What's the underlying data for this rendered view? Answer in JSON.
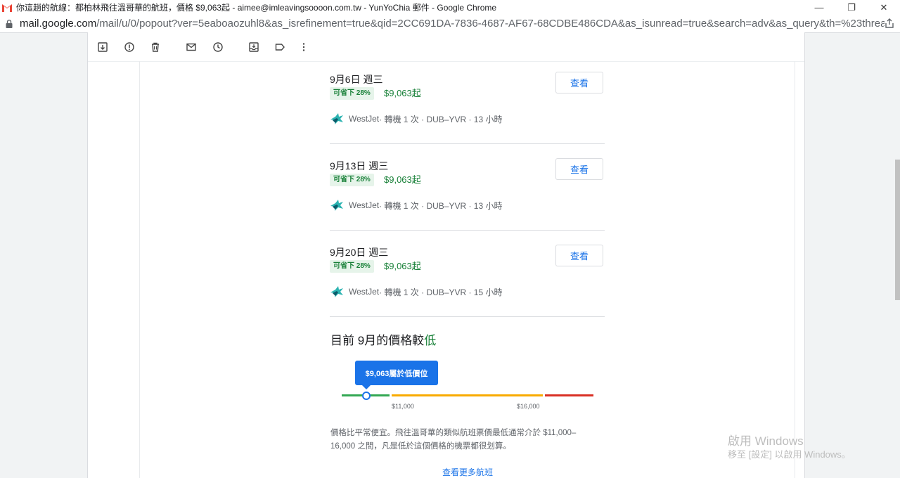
{
  "window": {
    "title": "你這趟的航線：都柏林飛往溫哥華的航班，價格 $9,063起 - aimee@imleavingsoooon.com.tw - YunYoChia 郵件 - Google Chrome",
    "controls": {
      "minimize": "—",
      "restore": "❐",
      "close": "✕"
    }
  },
  "address_bar": {
    "host": "mail.google.com",
    "path": "/mail/u/0/popout?ver=5eaboaozuhl8&as_isrefinement=true&qid=2CC691DA-7836-4687-AF67-68CDBE486CDA&as_isunread=true&search=adv&as_query&th=%23thread-f:176..."
  },
  "toolbar": {
    "icons": [
      "archive-icon",
      "report-spam-icon",
      "delete-icon",
      "mark-unread-icon",
      "snooze-icon",
      "move-to-icon",
      "label-icon",
      "more-icon"
    ]
  },
  "flights": [
    {
      "date": "9月6日 週三",
      "badge": "可省下 28%",
      "price": "$9,063起",
      "view": "查看",
      "airline": "WestJet",
      "details": " · 轉機 1 次 · DUB–YVR · 13 小時"
    },
    {
      "date": "9月13日 週三",
      "badge": "可省下 28%",
      "price": "$9,063起",
      "view": "查看",
      "airline": "WestJet",
      "details": " · 轉機 1 次 · DUB–YVR · 13 小時"
    },
    {
      "date": "9月20日 週三",
      "badge": "可省下 28%",
      "price": "$9,063起",
      "view": "查看",
      "airline": "WestJet",
      "details": " · 轉機 1 次 · DUB–YVR · 15 小時"
    }
  ],
  "price_insight": {
    "headline_prefix": "目前 9月的價格較",
    "headline_level": "低",
    "tooltip": "$9,063屬於低價位",
    "tick_low": "$11,000",
    "tick_high": "$16,000",
    "description": "價格比平常便宜。飛往溫哥華的類似航班票價最低通常介於 $11,000–16,000 之間，凡是低於這個價格的機票都很划算。",
    "more_link": "查看更多航班",
    "colors": {
      "low": "#34a853",
      "typical": "#f9ab00",
      "high": "#d93025",
      "accent": "#1a73e8"
    }
  },
  "watermark": {
    "line1": "啟用 Windows",
    "line2": "移至 [設定] 以啟用 Windows。"
  }
}
